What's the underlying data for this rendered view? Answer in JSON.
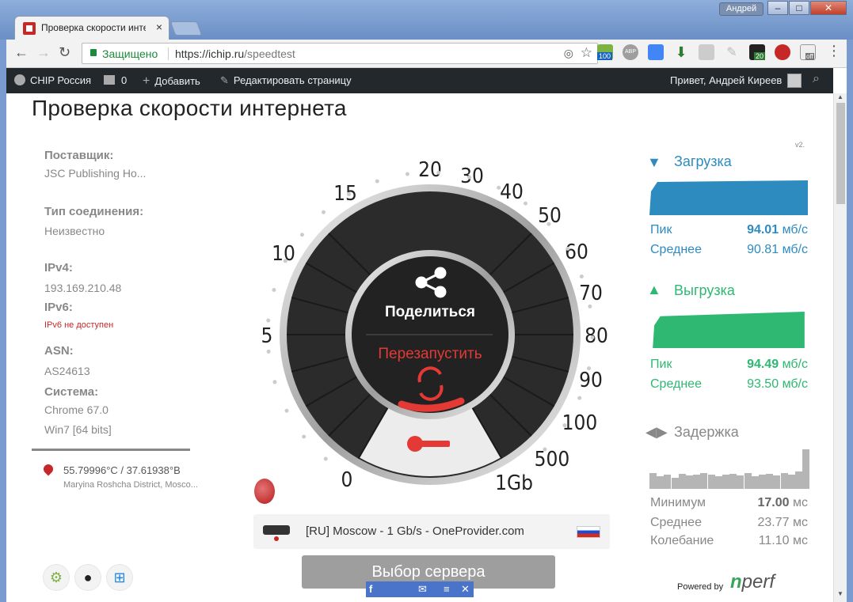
{
  "browser": {
    "tab_title": "Проверка скорости инте",
    "user": "Андрей",
    "secure_label": "Защищено",
    "url_host": "https://ichip.ru",
    "url_path": "/speedtest",
    "ext_badge_1": "100",
    "ext_badge_2": "20",
    "ext_badge_3": "off",
    "ext_abp": "ABP"
  },
  "wpbar": {
    "site": "CHIP Россия",
    "comments": "0",
    "add": "Добавить",
    "edit": "Редактировать страницу",
    "greet": "Привет, Андрей Киреев"
  },
  "page": {
    "title": "Проверка скорости интернета",
    "version": "v2."
  },
  "info": {
    "provider_label": "Поставщик:",
    "provider": "JSC Publishing Ho...",
    "conn_label": "Тип соединения:",
    "conn": "Неизвестно",
    "ipv4_label": "IPv4:",
    "ipv4": "193.169.210.48",
    "ipv6_label": "IPv6:",
    "ipv6": "IPv6 не доступен",
    "asn_label": "ASN:",
    "asn": "AS24613",
    "system_label": "Система:",
    "browser": "Chrome 67.0",
    "os": "Win7 [64 bits]",
    "coords": "55.79996°C / 37.61938°В",
    "place": "Maryina Roshcha District, Mosco..."
  },
  "gauge": {
    "ticks": [
      "0",
      "5",
      "10",
      "15",
      "20",
      "30",
      "40",
      "50",
      "60",
      "70",
      "80",
      "90",
      "100",
      "500",
      "1Gb"
    ],
    "share": "Поделиться",
    "restart": "Перезапустить"
  },
  "download": {
    "title": "Загрузка",
    "peak_label": "Пик",
    "peak": "94.01",
    "avg_label": "Среднее",
    "avg": "90.81",
    "unit": "мб/с",
    "color": "#2e8bc0"
  },
  "upload": {
    "title": "Выгрузка",
    "peak_label": "Пик",
    "peak": "94.49",
    "avg_label": "Среднее",
    "avg": "93.50",
    "unit": "мб/с",
    "color": "#2eb872"
  },
  "latency": {
    "title": "Задержка",
    "min_label": "Минимум",
    "min": "17.00",
    "avg_label": "Среднее",
    "avg": "23.77",
    "jit_label": "Колебание",
    "jit": "11.10",
    "unit": "мс"
  },
  "server": {
    "name": "[RU] Moscow - 1 Gb/s - OneProvider.com",
    "choose": "Выбор сервера"
  },
  "footer": {
    "powered": "Powered by",
    "nperf_n": "n",
    "nperf_rest": "perf"
  }
}
